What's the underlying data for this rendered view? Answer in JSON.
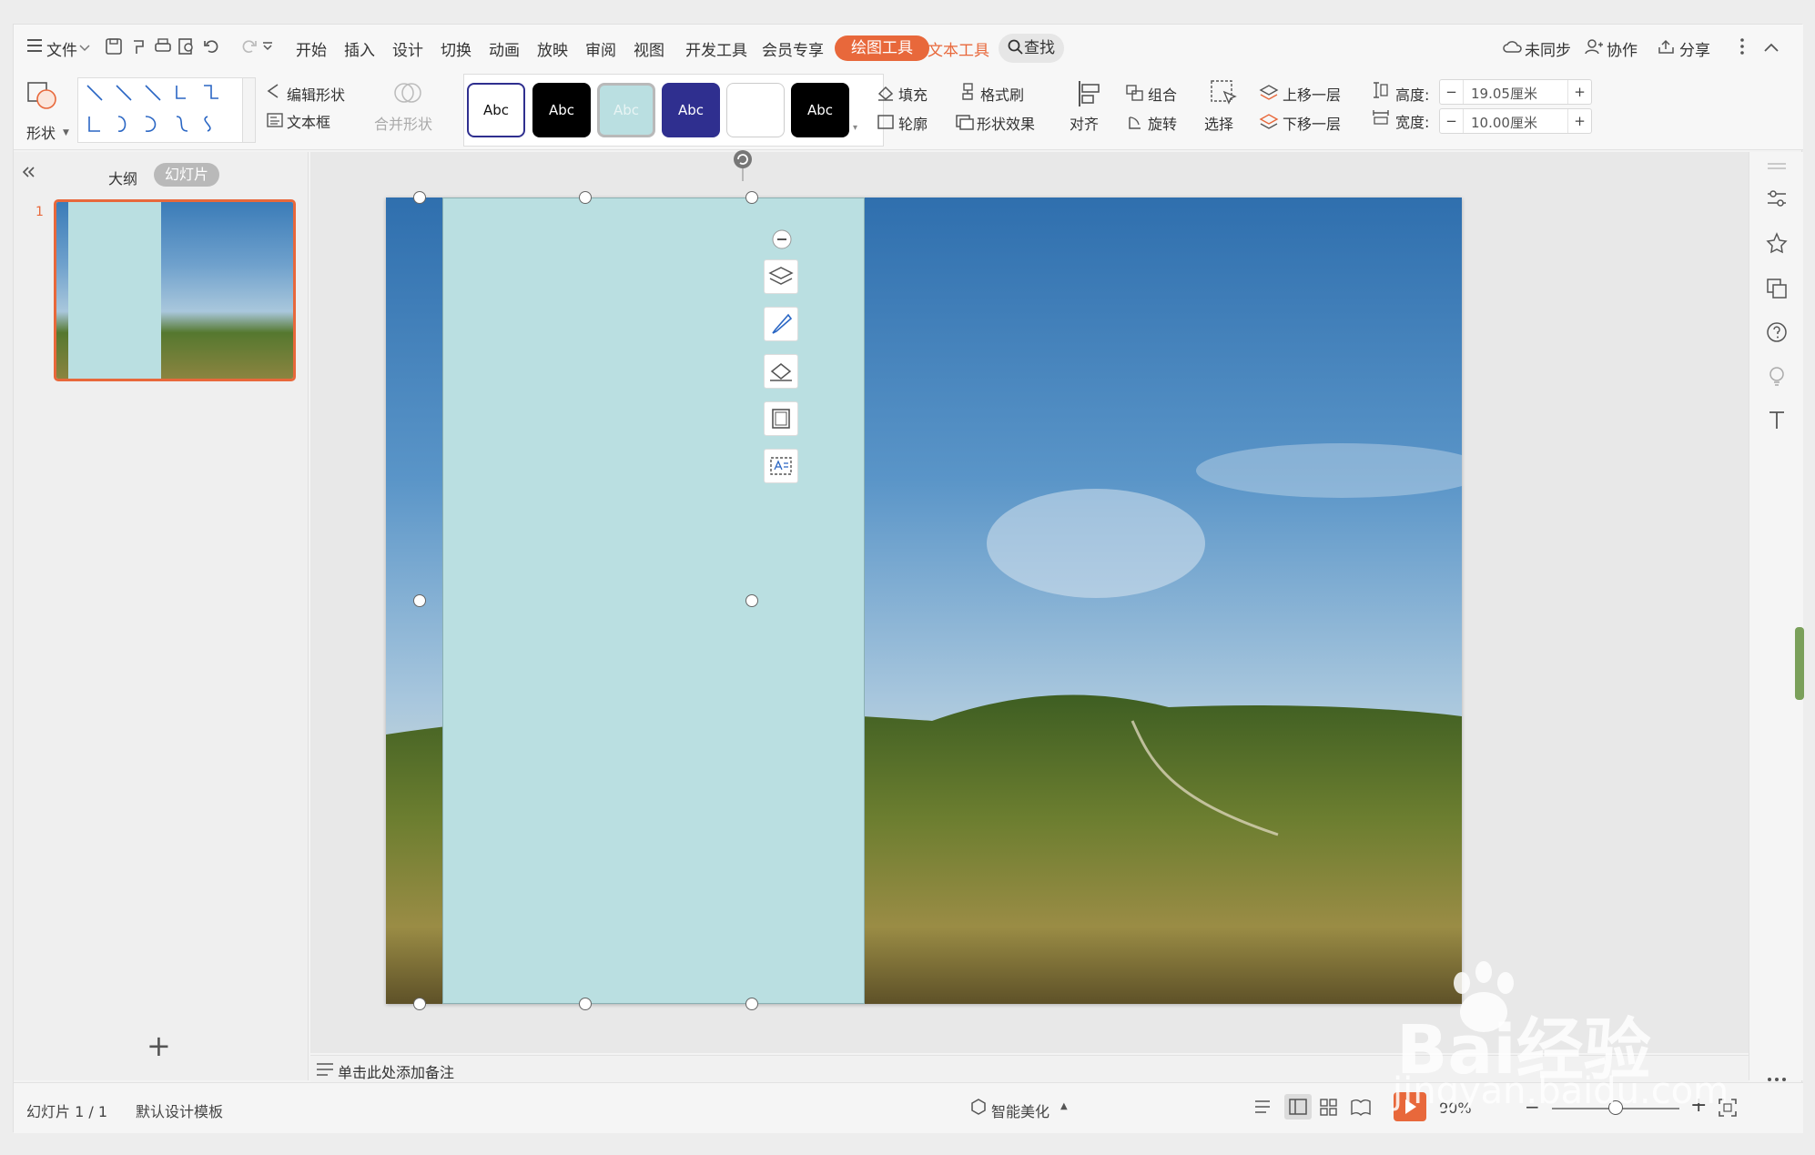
{
  "menu": {
    "file": "文件",
    "tabs": [
      "开始",
      "插入",
      "设计",
      "切换",
      "动画",
      "放映",
      "审阅",
      "视图",
      "开发工具",
      "会员专享"
    ],
    "active_tab": "绘图工具",
    "text_tools": "文本工具",
    "search": "查找",
    "sync": "未同步",
    "collab": "协作",
    "share": "分享"
  },
  "ribbon": {
    "shape": "形状",
    "edit_shape": "编辑形状",
    "text_box": "文本框",
    "merge_shape": "合并形状",
    "style_label": "Abc",
    "fill": "填充",
    "format_painter": "格式刷",
    "outline": "轮廓",
    "shape_effect": "形状效果",
    "align": "对齐",
    "group": "组合",
    "rotate": "旋转",
    "select": "选择",
    "bring_forward": "上移一层",
    "send_backward": "下移一层",
    "height_label": "高度:",
    "height_value": "19.05厘米",
    "width_label": "宽度:",
    "width_value": "10.00厘米"
  },
  "leftpanel": {
    "outline_tab": "大纲",
    "slides_tab": "幻灯片",
    "slide_number": "1",
    "add": "+"
  },
  "notes": {
    "placeholder": "单击此处添加备注"
  },
  "status": {
    "slide_count": "幻灯片 1 / 1",
    "template": "默认设计模板",
    "smart_beautify": "智能美化",
    "zoom": "90%"
  },
  "watermark": {
    "brand": "Bai经验",
    "url": "jingyan.baidu.com"
  },
  "colors": {
    "accent": "#e8683b",
    "shape_fill": "#badfe1",
    "style_swatches": [
      "#ffffff",
      "#000000",
      "#badfe1",
      "#2f2f8f",
      "#ffffff",
      "#000000"
    ]
  }
}
